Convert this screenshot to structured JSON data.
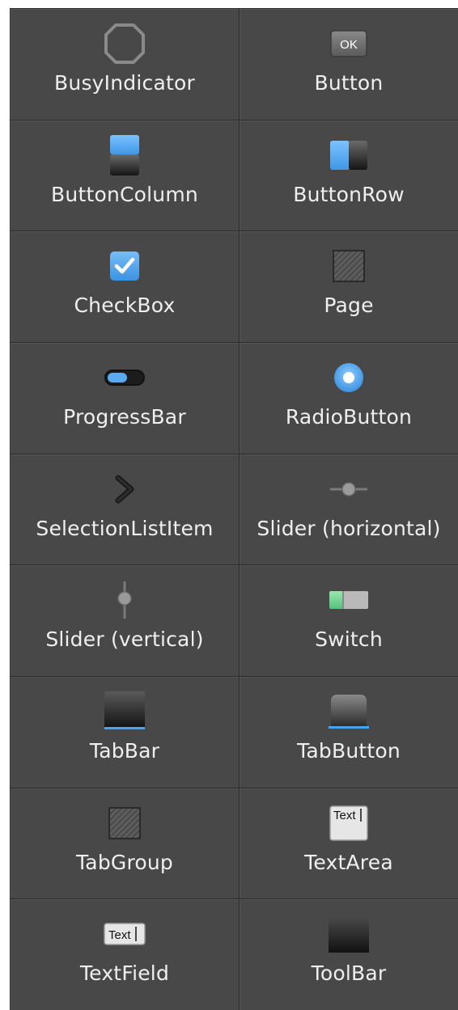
{
  "components": [
    {
      "label": "BusyIndicator",
      "icon": "busy-indicator-icon"
    },
    {
      "label": "Button",
      "icon": "button-icon",
      "icon_text": "OK"
    },
    {
      "label": "ButtonColumn",
      "icon": "button-column-icon"
    },
    {
      "label": "ButtonRow",
      "icon": "button-row-icon"
    },
    {
      "label": "CheckBox",
      "icon": "checkbox-icon"
    },
    {
      "label": "Page",
      "icon": "page-icon"
    },
    {
      "label": "ProgressBar",
      "icon": "progress-bar-icon"
    },
    {
      "label": "RadioButton",
      "icon": "radio-button-icon"
    },
    {
      "label": "SelectionListItem",
      "icon": "selection-list-item-icon"
    },
    {
      "label": "Slider (horizontal)",
      "icon": "slider-horizontal-icon"
    },
    {
      "label": "Slider (vertical)",
      "icon": "slider-vertical-icon"
    },
    {
      "label": "Switch",
      "icon": "switch-icon"
    },
    {
      "label": "TabBar",
      "icon": "tab-bar-icon"
    },
    {
      "label": "TabButton",
      "icon": "tab-button-icon"
    },
    {
      "label": "TabGroup",
      "icon": "tab-group-icon"
    },
    {
      "label": "TextArea",
      "icon": "text-area-icon",
      "icon_text": "Text"
    },
    {
      "label": "TextField",
      "icon": "text-field-icon",
      "icon_text": "Text"
    },
    {
      "label": "ToolBar",
      "icon": "toolbar-icon"
    }
  ],
  "colors": {
    "background": "#484848",
    "grid_line": "#2b2b2b",
    "label": "#efefef",
    "accent_blue": "#4aa3f0"
  }
}
